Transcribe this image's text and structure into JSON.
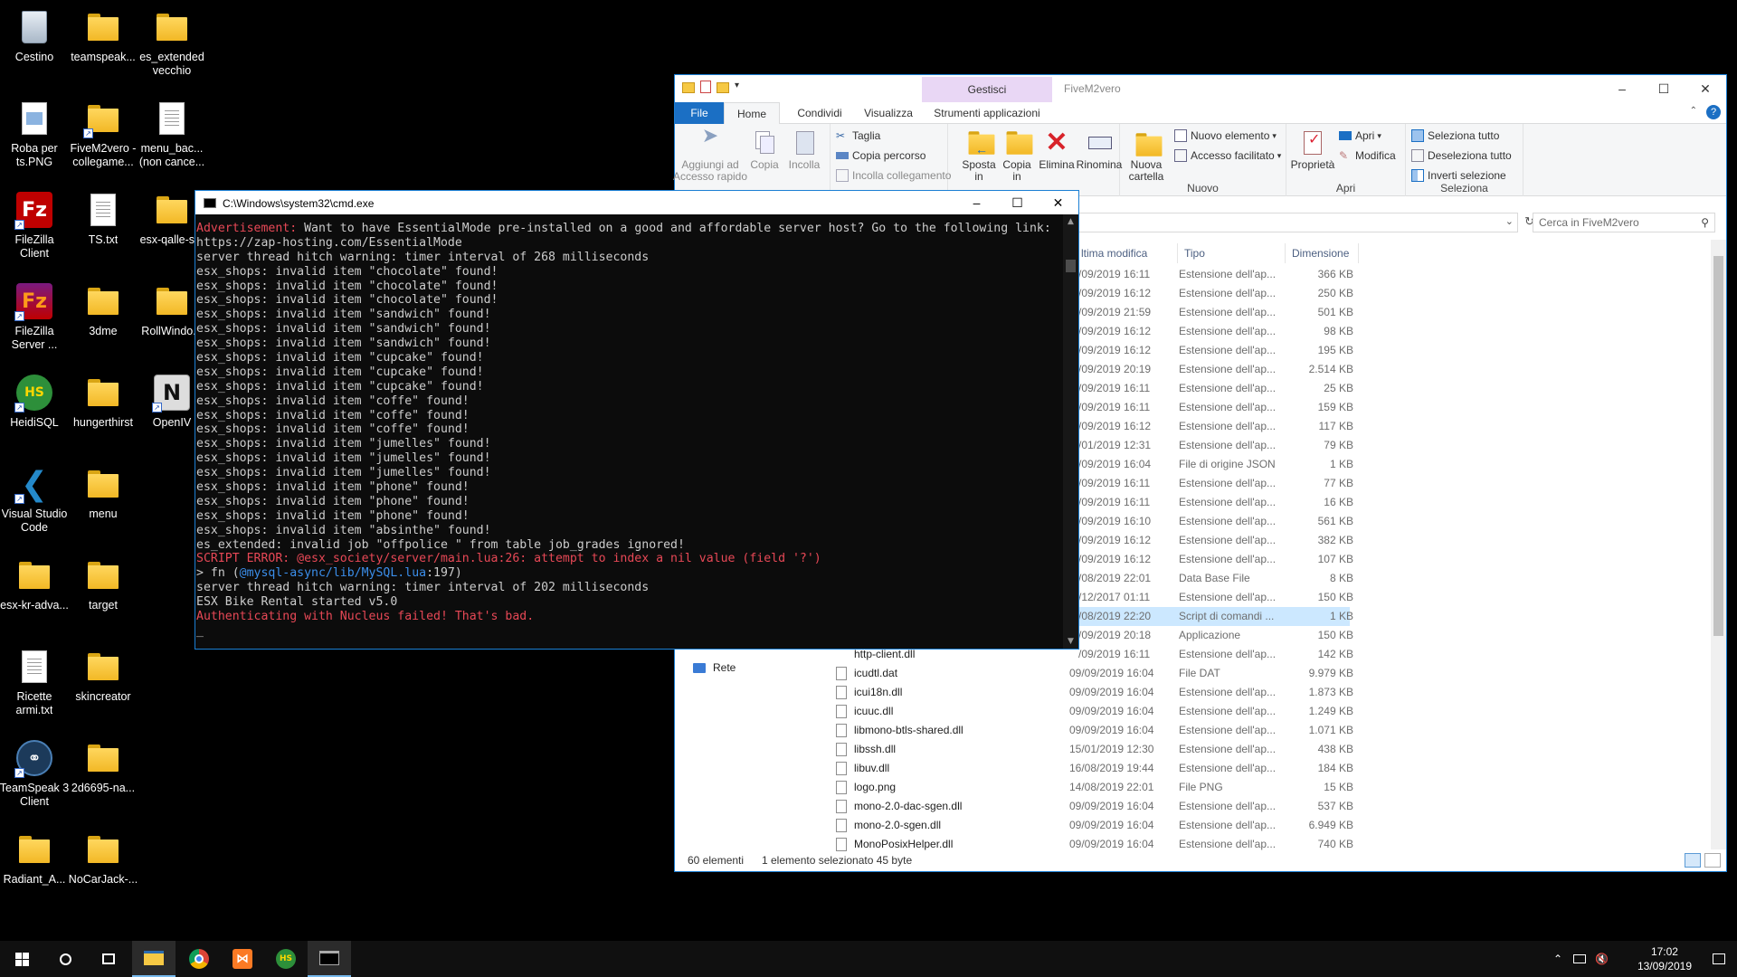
{
  "desktop": {
    "icons": [
      {
        "label": "Cestino",
        "icon": "recycle-bin-icon"
      },
      {
        "label": "teamspeak...",
        "icon": "folder-icon"
      },
      {
        "label": "es_extended\nvecchio",
        "icon": "folder-icon"
      },
      {
        "label": "Roba per\nts.PNG",
        "icon": "image-file-icon"
      },
      {
        "label": "FiveM2vero -\ncollegame...",
        "icon": "folder-shortcut-icon"
      },
      {
        "label": "menu_bac...\n(non cance...",
        "icon": "text-file-icon"
      },
      {
        "label": "FileZilla\nClient",
        "icon": "filezilla-client-icon"
      },
      {
        "label": "TS.txt",
        "icon": "text-file-icon"
      },
      {
        "label": "esx-qalle-s...",
        "icon": "folder-icon"
      },
      {
        "label": "FileZilla\nServer ...",
        "icon": "filezilla-server-icon"
      },
      {
        "label": "3dme",
        "icon": "folder-icon"
      },
      {
        "label": "RollWindo...",
        "icon": "folder-icon"
      },
      {
        "label": "HeidiSQL",
        "icon": "heidisql-icon"
      },
      {
        "label": "hungerthirst",
        "icon": "folder-icon"
      },
      {
        "label": "OpenIV",
        "icon": "openiv-icon"
      },
      {
        "label": "Visual Studio\nCode",
        "icon": "vscode-icon"
      },
      {
        "label": "menu",
        "icon": "folder-icon"
      },
      {
        "label": "esx-kr-adva...",
        "icon": "folder-icon"
      },
      {
        "label": "target",
        "icon": "folder-icon"
      },
      {
        "label": "Ricette\narmi.txt",
        "icon": "text-file-icon"
      },
      {
        "label": "skincreator",
        "icon": "folder-icon"
      },
      {
        "label": "TeamSpeak 3\nClient",
        "icon": "teamspeak-icon"
      },
      {
        "label": "2d6695-na...",
        "icon": "folder-icon"
      },
      {
        "label": "Radiant_A...",
        "icon": "folder-icon"
      },
      {
        "label": "NoCarJack-...",
        "icon": "folder-icon"
      }
    ]
  },
  "explorer": {
    "title": "FiveM2vero",
    "context_tab": "Gestisci",
    "tabs": {
      "file": "File",
      "home": "Home",
      "share": "Condividi",
      "view": "Visualizza",
      "apptools": "Strumenti applicazioni"
    },
    "ribbon": {
      "pin": "Aggiungi ad\nAccesso rapido",
      "copy": "Copia",
      "paste": "Incolla",
      "cut": "Taglia",
      "copy_path": "Copia percorso",
      "paste_shortcut": "Incolla collegamento",
      "move_to": "Sposta\nin",
      "copy_to": "Copia\nin",
      "delete": "Elimina",
      "rename": "Rinomina",
      "new_folder": "Nuova\ncartella",
      "new_item": "Nuovo elemento",
      "easy_access": "Accesso facilitato",
      "group_new": "Nuovo",
      "properties": "Proprietà",
      "open": "Apri",
      "edit": "Modifica",
      "group_open": "Apri",
      "select_all": "Seleziona tutto",
      "select_none": "Deseleziona tutto",
      "invert_selection": "Inverti selezione",
      "group_select": "Seleziona"
    },
    "search_placeholder": "Cerca in FiveM2vero",
    "columns": {
      "modified": "ltima modifica",
      "type": "Tipo",
      "size": "Dimensione"
    },
    "nav_network": "Rete",
    "files": [
      {
        "name": "",
        "modified": "/09/2019 16:11",
        "type": "Estensione dell'ap...",
        "size": "366 KB"
      },
      {
        "name": "",
        "modified": "/09/2019 16:12",
        "type": "Estensione dell'ap...",
        "size": "250 KB"
      },
      {
        "name": "",
        "modified": "/09/2019 21:59",
        "type": "Estensione dell'ap...",
        "size": "501 KB"
      },
      {
        "name": "",
        "modified": "/09/2019 16:12",
        "type": "Estensione dell'ap...",
        "size": "98 KB"
      },
      {
        "name": "",
        "modified": "/09/2019 16:12",
        "type": "Estensione dell'ap...",
        "size": "195 KB"
      },
      {
        "name": "",
        "modified": "/09/2019 20:19",
        "type": "Estensione dell'ap...",
        "size": "2.514 KB"
      },
      {
        "name": "",
        "modified": "/09/2019 16:11",
        "type": "Estensione dell'ap...",
        "size": "25 KB"
      },
      {
        "name": "",
        "modified": "/09/2019 16:11",
        "type": "Estensione dell'ap...",
        "size": "159 KB"
      },
      {
        "name": "",
        "modified": "/09/2019 16:12",
        "type": "Estensione dell'ap...",
        "size": "117 KB"
      },
      {
        "name": "",
        "modified": "/01/2019 12:31",
        "type": "Estensione dell'ap...",
        "size": "79 KB"
      },
      {
        "name": "",
        "modified": "/09/2019 16:04",
        "type": "File di origine JSON",
        "size": "1 KB"
      },
      {
        "name": "",
        "modified": "/09/2019 16:11",
        "type": "Estensione dell'ap...",
        "size": "77 KB"
      },
      {
        "name": "",
        "modified": "/09/2019 16:11",
        "type": "Estensione dell'ap...",
        "size": "16 KB"
      },
      {
        "name": "",
        "modified": "/09/2019 16:10",
        "type": "Estensione dell'ap...",
        "size": "561 KB"
      },
      {
        "name": "",
        "modified": "/09/2019 16:12",
        "type": "Estensione dell'ap...",
        "size": "382 KB"
      },
      {
        "name": "",
        "modified": "/09/2019 16:12",
        "type": "Estensione dell'ap...",
        "size": "107 KB"
      },
      {
        "name": "",
        "modified": "/08/2019 22:01",
        "type": "Data Base File",
        "size": "8 KB"
      },
      {
        "name": "",
        "modified": "/12/2017 01:11",
        "type": "Estensione dell'ap...",
        "size": "150 KB"
      },
      {
        "name": "",
        "modified": "/08/2019 22:20",
        "type": "Script di comandi ...",
        "size": "1 KB"
      },
      {
        "name": "",
        "modified": "/09/2019 20:18",
        "type": "Applicazione",
        "size": "150 KB"
      },
      {
        "name": "http-client.dll",
        "modified": "/09/2019 16:11",
        "type": "Estensione dell'ap...",
        "size": "142 KB"
      },
      {
        "name": "icudtl.dat",
        "modified": "09/09/2019 16:04",
        "type": "File DAT",
        "size": "9.979 KB"
      },
      {
        "name": "icui18n.dll",
        "modified": "09/09/2019 16:04",
        "type": "Estensione dell'ap...",
        "size": "1.873 KB"
      },
      {
        "name": "icuuc.dll",
        "modified": "09/09/2019 16:04",
        "type": "Estensione dell'ap...",
        "size": "1.249 KB"
      },
      {
        "name": "libmono-btls-shared.dll",
        "modified": "09/09/2019 16:04",
        "type": "Estensione dell'ap...",
        "size": "1.071 KB"
      },
      {
        "name": "libssh.dll",
        "modified": "15/01/2019 12:30",
        "type": "Estensione dell'ap...",
        "size": "438 KB"
      },
      {
        "name": "libuv.dll",
        "modified": "16/08/2019 19:44",
        "type": "Estensione dell'ap...",
        "size": "184 KB"
      },
      {
        "name": "logo.png",
        "modified": "14/08/2019 22:01",
        "type": "File PNG",
        "size": "15 KB"
      },
      {
        "name": "mono-2.0-dac-sgen.dll",
        "modified": "09/09/2019 16:04",
        "type": "Estensione dell'ap...",
        "size": "537 KB"
      },
      {
        "name": "mono-2.0-sgen.dll",
        "modified": "09/09/2019 16:04",
        "type": "Estensione dell'ap...",
        "size": "6.949 KB"
      },
      {
        "name": "MonoPosixHelper.dll",
        "modified": "09/09/2019 16:04",
        "type": "Estensione dell'ap...",
        "size": "740 KB"
      }
    ],
    "status_count": "60 elementi",
    "status_selected": "1 elemento selezionato  45 byte"
  },
  "cmd": {
    "title": "C:\\Windows\\system32\\cmd.exe",
    "lines": [
      {
        "segs": [
          {
            "t": "Advertisement:",
            "c": "red"
          },
          {
            "t": " Want to have EssentialMode pre-installed on a good and affordable server host? Go to the following link:",
            "c": ""
          }
        ]
      },
      {
        "segs": [
          {
            "t": "https://zap-hosting.com/EssentialMode",
            "c": ""
          }
        ]
      },
      {
        "segs": [
          {
            "t": "server thread hitch warning: timer interval of 268 milliseconds",
            "c": ""
          }
        ]
      },
      {
        "segs": [
          {
            "t": "esx_shops: invalid item \"chocolate\" found!",
            "c": ""
          }
        ]
      },
      {
        "segs": [
          {
            "t": "esx_shops: invalid item \"chocolate\" found!",
            "c": ""
          }
        ]
      },
      {
        "segs": [
          {
            "t": "esx_shops: invalid item \"chocolate\" found!",
            "c": ""
          }
        ]
      },
      {
        "segs": [
          {
            "t": "esx_shops: invalid item \"sandwich\" found!",
            "c": ""
          }
        ]
      },
      {
        "segs": [
          {
            "t": "esx_shops: invalid item \"sandwich\" found!",
            "c": ""
          }
        ]
      },
      {
        "segs": [
          {
            "t": "esx_shops: invalid item \"sandwich\" found!",
            "c": ""
          }
        ]
      },
      {
        "segs": [
          {
            "t": "esx_shops: invalid item \"cupcake\" found!",
            "c": ""
          }
        ]
      },
      {
        "segs": [
          {
            "t": "esx_shops: invalid item \"cupcake\" found!",
            "c": ""
          }
        ]
      },
      {
        "segs": [
          {
            "t": "esx_shops: invalid item \"cupcake\" found!",
            "c": ""
          }
        ]
      },
      {
        "segs": [
          {
            "t": "esx_shops: invalid item \"coffe\" found!",
            "c": ""
          }
        ]
      },
      {
        "segs": [
          {
            "t": "esx_shops: invalid item \"coffe\" found!",
            "c": ""
          }
        ]
      },
      {
        "segs": [
          {
            "t": "esx_shops: invalid item \"coffe\" found!",
            "c": ""
          }
        ]
      },
      {
        "segs": [
          {
            "t": "esx_shops: invalid item \"jumelles\" found!",
            "c": ""
          }
        ]
      },
      {
        "segs": [
          {
            "t": "esx_shops: invalid item \"jumelles\" found!",
            "c": ""
          }
        ]
      },
      {
        "segs": [
          {
            "t": "esx_shops: invalid item \"jumelles\" found!",
            "c": ""
          }
        ]
      },
      {
        "segs": [
          {
            "t": "esx_shops: invalid item \"phone\" found!",
            "c": ""
          }
        ]
      },
      {
        "segs": [
          {
            "t": "esx_shops: invalid item \"phone\" found!",
            "c": ""
          }
        ]
      },
      {
        "segs": [
          {
            "t": "esx_shops: invalid item \"phone\" found!",
            "c": ""
          }
        ]
      },
      {
        "segs": [
          {
            "t": "esx_shops: invalid item \"absinthe\" found!",
            "c": ""
          }
        ]
      },
      {
        "segs": [
          {
            "t": "es_extended: invalid job \"offpolice \" from table job_grades ignored!",
            "c": ""
          }
        ]
      },
      {
        "segs": [
          {
            "t": "SCRIPT ERROR: @esx_society/server/main.lua:26: attempt to index a nil value (field '?')",
            "c": "red"
          }
        ]
      },
      {
        "segs": [
          {
            "t": "> fn (",
            "c": ""
          },
          {
            "t": "@mysql-async/lib/MySQL.lua",
            "c": "blue"
          },
          {
            "t": ":197)",
            "c": ""
          }
        ]
      },
      {
        "segs": [
          {
            "t": "server thread hitch warning: timer interval of 202 milliseconds",
            "c": ""
          }
        ]
      },
      {
        "segs": [
          {
            "t": "ESX Bike Rental started v5.0",
            "c": ""
          }
        ]
      },
      {
        "segs": [
          {
            "t": "Authenticating with Nucleus failed! That's bad.",
            "c": "red"
          }
        ]
      },
      {
        "segs": [
          {
            "t": "_",
            "c": ""
          }
        ]
      }
    ]
  },
  "taskbar": {
    "time": "17:02",
    "date": "13/09/2019"
  }
}
